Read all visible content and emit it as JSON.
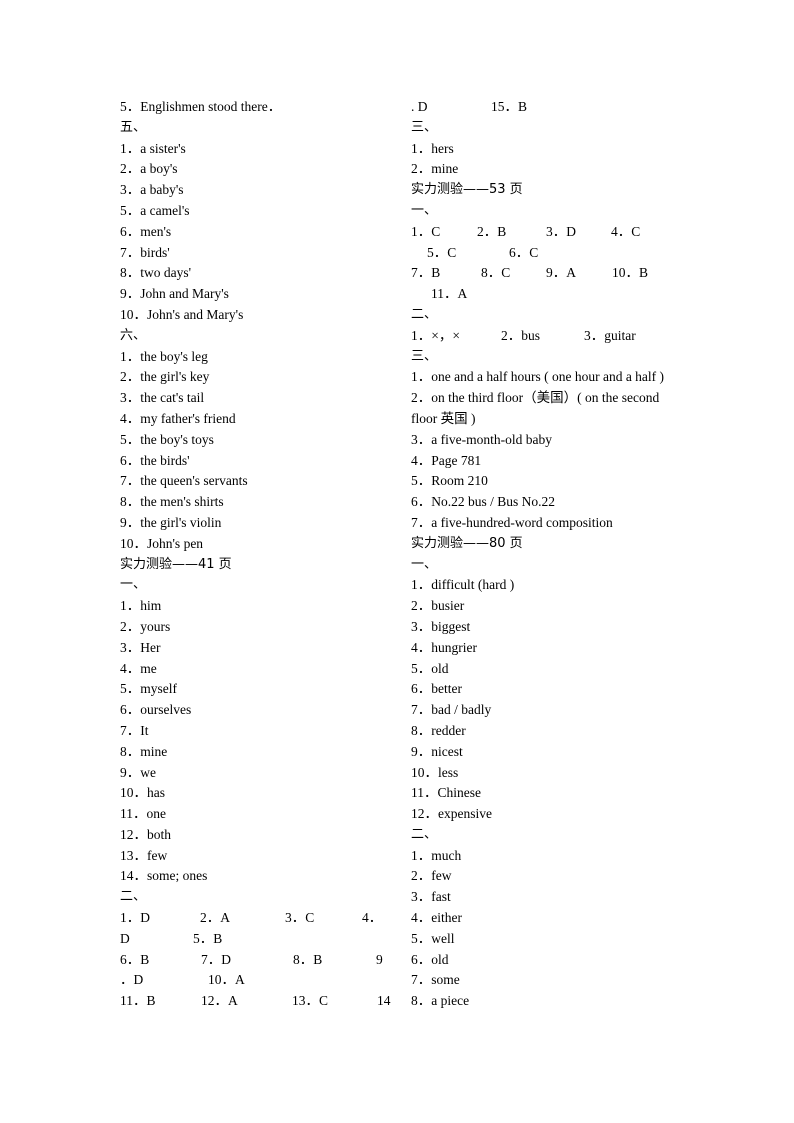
{
  "left": {
    "lines": [
      {
        "text": "5．Englishmen stood there．"
      },
      {
        "text": "五、",
        "heading": true
      },
      {
        "text": "1．a sister's"
      },
      {
        "text": "2．a boy's"
      },
      {
        "text": "3．a baby's"
      },
      {
        "text": "5．a camel's"
      },
      {
        "text": "6．men's"
      },
      {
        "text": "7．birds'"
      },
      {
        "text": "8．two days'"
      },
      {
        "text": "9．John and Mary's"
      },
      {
        "text": "10．John's and Mary's"
      },
      {
        "text": "六、",
        "heading": true
      },
      {
        "text": "1．the boy's leg"
      },
      {
        "text": "2．the girl's key"
      },
      {
        "text": "3．the cat's tail"
      },
      {
        "text": "4．my father's friend"
      },
      {
        "text": "5．the boy's toys"
      },
      {
        "text": "6．the birds'"
      },
      {
        "text": "7．the queen's servants"
      },
      {
        "text": "8．the men's shirts"
      },
      {
        "text": "9．the girl's violin"
      },
      {
        "text": "10．John's pen"
      },
      {
        "text": "实力测验——41 页",
        "heading": true
      },
      {
        "text": "一、",
        "heading": true
      },
      {
        "text": "1．him"
      },
      {
        "text": "2．yours"
      },
      {
        "text": "3．Her"
      },
      {
        "text": "4．me"
      },
      {
        "text": "5．myself"
      },
      {
        "text": "6．ourselves"
      },
      {
        "text": "7．It"
      },
      {
        "text": "8．mine"
      },
      {
        "text": "9．we"
      },
      {
        "text": "10．has"
      },
      {
        "text": "11．one"
      },
      {
        "text": "12．both"
      },
      {
        "text": "13．few"
      },
      {
        "text": "14．some; ones"
      },
      {
        "text": "二、",
        "heading": true
      }
    ],
    "choice_rows": [
      [
        "1．D",
        "2．A",
        "3．C",
        "4．"
      ],
      [
        "D",
        "5．B"
      ],
      [
        "6．B",
        "7．D",
        "8．B",
        "9"
      ],
      [
        "．D",
        "10．A"
      ],
      [
        "11．B",
        "12．A",
        "13．C",
        "14"
      ]
    ]
  },
  "right": {
    "top_row": [
      ". D",
      "15．B"
    ],
    "lines_a": [
      {
        "text": "三、",
        "heading": true
      },
      {
        "text": "1．hers"
      },
      {
        "text": "2．mine"
      },
      {
        "text": "实力测验——53 页",
        "heading": true
      },
      {
        "text": "一、",
        "heading": true
      }
    ],
    "choice_rows": [
      [
        "1．C",
        "2．B",
        "3．D",
        "4．C"
      ],
      [
        "5．C",
        "6．C"
      ],
      [
        "7．B",
        "8．C",
        "9．A",
        "10．B"
      ],
      [
        "11．A"
      ]
    ],
    "lines_b": [
      {
        "text": "二、",
        "heading": true
      }
    ],
    "row_b": [
      "1．×，×",
      "2．bus",
      "3．guitar"
    ],
    "lines_c": [
      {
        "text": "三、",
        "heading": true
      },
      {
        "text": "1．one and a half hours ( one hour and a half )"
      },
      {
        "text": "2．on the third floor（美国）( on the second"
      },
      {
        "text": "floor  英国  )"
      },
      {
        "text": "3．a five-month-old baby"
      },
      {
        "text": "4．Page 781"
      },
      {
        "text": "5．Room 210"
      },
      {
        "text": "6．No.22 bus / Bus No.22"
      },
      {
        "text": "7．a five-hundred-word composition"
      },
      {
        "text": "实力测验——80 页",
        "heading": true
      },
      {
        "text": "一、",
        "heading": true
      },
      {
        "text": "1．difficult (hard )"
      },
      {
        "text": "2．busier"
      },
      {
        "text": "3．biggest"
      },
      {
        "text": "4．hungrier"
      },
      {
        "text": "5．old"
      },
      {
        "text": "6．better"
      },
      {
        "text": "7．bad / badly"
      },
      {
        "text": "8．redder"
      },
      {
        "text": "9．nicest"
      },
      {
        "text": "10．less"
      },
      {
        "text": "11．Chinese"
      },
      {
        "text": "12．expensive"
      },
      {
        "text": "二、",
        "heading": true
      },
      {
        "text": "1．much"
      },
      {
        "text": "2．few"
      },
      {
        "text": "3．fast"
      },
      {
        "text": "4．either"
      },
      {
        "text": "5．well"
      },
      {
        "text": "6．old"
      },
      {
        "text": "7．some"
      },
      {
        "text": "8．a piece"
      }
    ]
  }
}
